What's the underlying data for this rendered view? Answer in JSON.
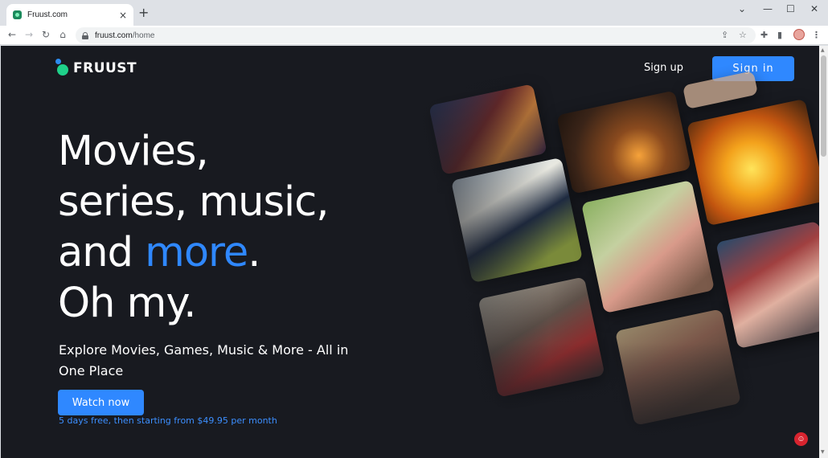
{
  "browser": {
    "tab_title": "Fruust.com",
    "tab_close": "×",
    "new_tab": "+",
    "url_host": "fruust.com",
    "url_path": "/home",
    "win_minimize": "—",
    "win_maximize": "☐",
    "win_close": "✕",
    "win_tabsearch": "⌄"
  },
  "header": {
    "brand": "FRUUST",
    "signup_label": "Sign up",
    "signin_label": "Sign in"
  },
  "hero": {
    "line1": "Movies,",
    "line2": "series, music,",
    "line3_start": "and ",
    "line3_accent": "more",
    "line3_end": ".",
    "line4": "Oh my.",
    "subtitle": "Explore Movies, Games, Music & More - All in One Place",
    "cta_label": "Watch now",
    "price_note": "5 days free, then starting from $49.95 per month"
  },
  "colors": {
    "page_bg": "#181a20",
    "accent": "#2f88ff",
    "brand_green": "#1fd18a"
  },
  "icons": {
    "back": "←",
    "forward": "→",
    "reload": "↻",
    "home": "⌂",
    "share": "⇪",
    "star": "☆",
    "extensions": "✚",
    "sidepanel": "▮",
    "menu": "⋮",
    "help": "☺"
  }
}
